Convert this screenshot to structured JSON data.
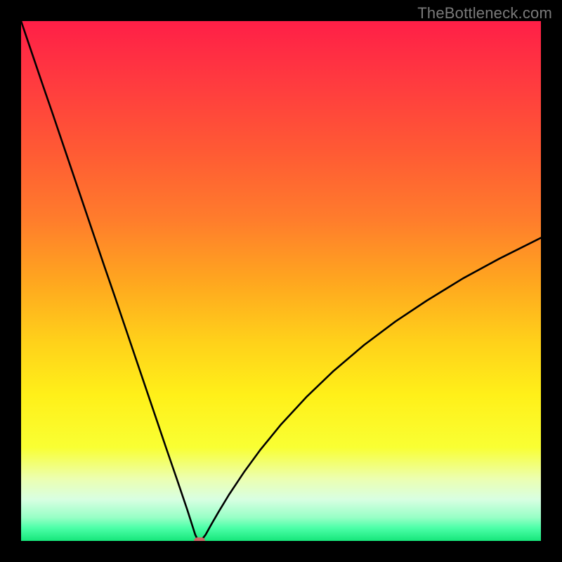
{
  "watermark": "TheBottleneck.com",
  "marker_color": "#cc6666",
  "gradient_stops": [
    {
      "offset": 0.0,
      "color": "#ff1f47"
    },
    {
      "offset": 0.12,
      "color": "#ff3b3f"
    },
    {
      "offset": 0.25,
      "color": "#ff5a34"
    },
    {
      "offset": 0.38,
      "color": "#ff7c2c"
    },
    {
      "offset": 0.5,
      "color": "#ffa61f"
    },
    {
      "offset": 0.62,
      "color": "#ffd21a"
    },
    {
      "offset": 0.72,
      "color": "#fff019"
    },
    {
      "offset": 0.82,
      "color": "#f9ff33"
    },
    {
      "offset": 0.88,
      "color": "#ecffb0"
    },
    {
      "offset": 0.92,
      "color": "#d8ffe2"
    },
    {
      "offset": 0.955,
      "color": "#97ffc6"
    },
    {
      "offset": 0.975,
      "color": "#4cffa8"
    },
    {
      "offset": 1.0,
      "color": "#16e67a"
    }
  ],
  "chart_data": {
    "type": "line",
    "title": "",
    "xlabel": "",
    "ylabel": "",
    "xlim": [
      0,
      100
    ],
    "ylim": [
      0,
      100
    ],
    "grid": false,
    "legend": false,
    "series": [
      {
        "name": "bottleneck-curve",
        "x": [
          0,
          2,
          4,
          6,
          8,
          10,
          12,
          14,
          16,
          18,
          20,
          22,
          24,
          26,
          28,
          30,
          32,
          33.5,
          34,
          34.3,
          34.8,
          35.5,
          36.5,
          38,
          40,
          43,
          46,
          50,
          55,
          60,
          66,
          72,
          78,
          85,
          92,
          100
        ],
        "y": [
          100,
          94.1,
          88.2,
          82.4,
          76.5,
          70.6,
          64.7,
          58.8,
          52.9,
          47.1,
          41.2,
          35.3,
          29.4,
          23.5,
          17.6,
          11.8,
          5.9,
          1.2,
          0.2,
          0.0,
          0.3,
          1.2,
          3.0,
          5.6,
          8.9,
          13.4,
          17.5,
          22.4,
          27.8,
          32.6,
          37.7,
          42.2,
          46.2,
          50.5,
          54.3,
          58.3
        ]
      }
    ],
    "marker": {
      "x": 34.3,
      "y": 0.0
    }
  }
}
